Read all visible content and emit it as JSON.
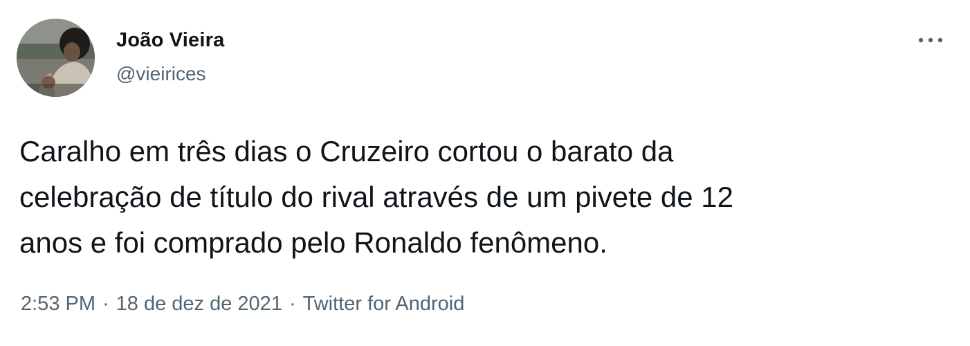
{
  "author": {
    "display_name": "João Vieira",
    "handle": "@vieirices"
  },
  "tweet": {
    "text_lines": [
      "Caralho em três dias o Cruzeiro cortou o barato da",
      "celebração de título do rival através de um pivete de 12",
      "anos e foi comprado pelo Ronaldo fenômeno."
    ]
  },
  "meta": {
    "time": "2:53 PM",
    "separator": "·",
    "date": "18 de dez de 2021",
    "source": "Twitter for Android"
  },
  "icons": {
    "more": "more-horizontal-icon",
    "avatar": "profile-photo"
  },
  "colors": {
    "text_primary": "#0f1419",
    "text_secondary": "#536471",
    "background": "#ffffff"
  }
}
